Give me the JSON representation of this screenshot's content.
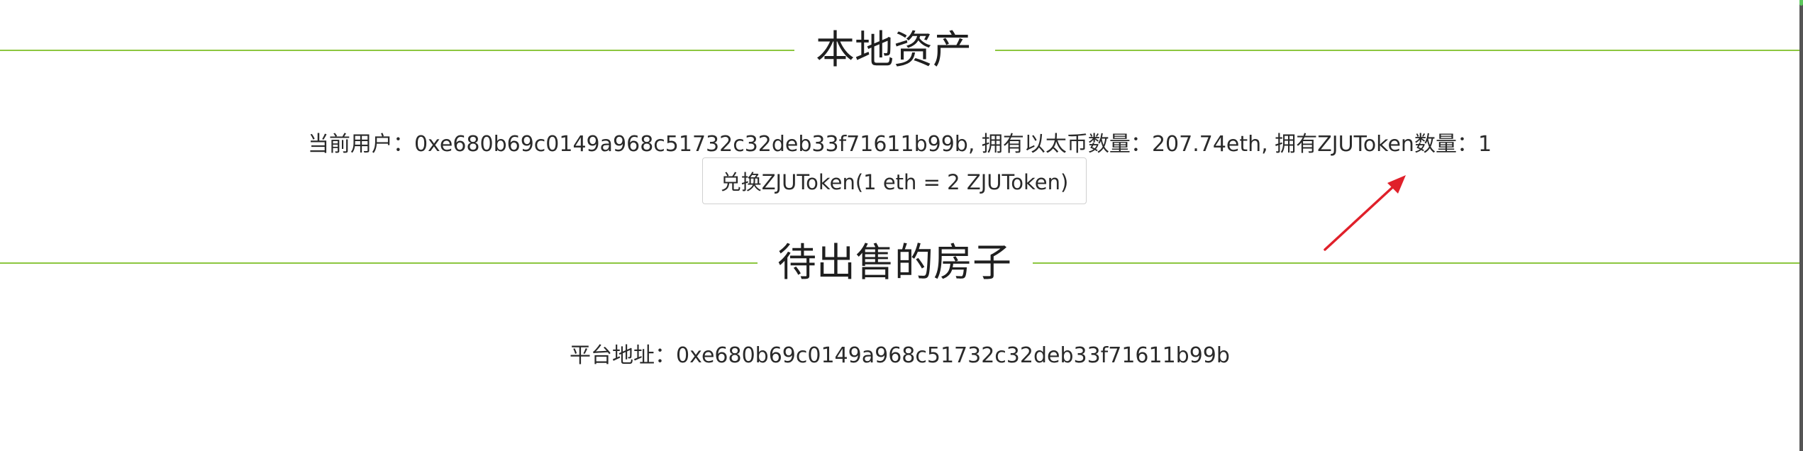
{
  "local_assets": {
    "title": "本地资产",
    "user_label": "当前用户：",
    "user_address": "0xe680b69c0149a968c51732c32deb33f71611b99b",
    "eth_label": ", 拥有以太币数量：",
    "eth_amount": "207.74eth",
    "token_label": ", 拥有ZJUToken数量：",
    "token_amount": "1",
    "exchange_button": "兑换ZJUToken(1 eth = 2 ZJUToken)"
  },
  "houses_for_sale": {
    "title": "待出售的房子",
    "platform_label": "平台地址：",
    "platform_address": "0xe680b69c0149a968c51732c32deb33f71611b99b"
  },
  "colors": {
    "divider": "#8cc63f",
    "annotation_arrow": "#e0202a"
  },
  "icons": {
    "annotation": "arrow-annotation-icon"
  }
}
